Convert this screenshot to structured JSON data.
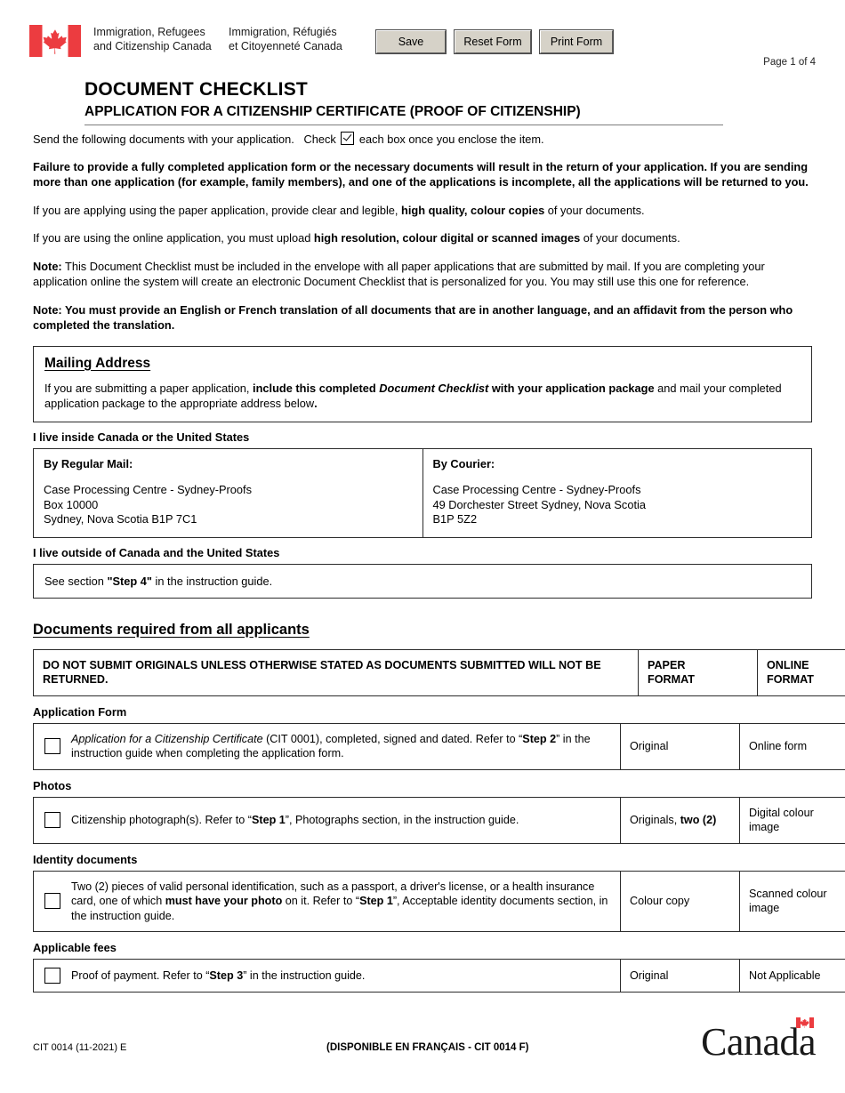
{
  "header": {
    "department_en": "Immigration, Refugees\nand Citizenship Canada",
    "department_fr": "Immigration, Réfugiés\net Citoyenneté Canada",
    "buttons": {
      "save": "Save",
      "reset": "Reset Form",
      "print": "Print Form"
    },
    "page_indicator": "Page 1 of 4"
  },
  "title": {
    "main": "DOCUMENT CHECKLIST",
    "sub": "APPLICATION FOR A CITIZENSHIP CERTIFICATE (PROOF OF CITIZENSHIP)"
  },
  "intro": {
    "line1_a": "Send the following documents with your application.",
    "line1_b": "Check",
    "line1_c": "each box once you enclose the item.",
    "warning": "Failure to provide a fully completed application form or the necessary documents will result in the return of your application. If you are sending more than one application (for example, family members), and one of the applications is incomplete, all the applications will be returned to you.",
    "paper_a": "If you are applying using the paper application, provide clear and legible, ",
    "paper_b": "high quality, colour copies",
    "paper_c": " of your documents.",
    "online_a": "If you are using the online application, you must upload ",
    "online_b": "high resolution, colour digital or scanned images",
    "online_c": " of your documents.",
    "note1_label": "Note:",
    "note1_text": " This Document Checklist must be included in the envelope with all paper applications that are submitted by mail. If you are completing your application online the system will create an electronic Document Checklist that is personalized for you. You may still use this one for reference.",
    "note2_text": "Note: You must provide an English or French translation of all documents that are in another language, and an affidavit from the person who completed the translation."
  },
  "mailing": {
    "heading": "Mailing Address",
    "text_a": "If you are submitting a paper application, ",
    "text_b": "include this completed ",
    "text_b_italic": "Document Checklist",
    "text_b2": " with your application package",
    "text_c": " and mail your completed application package to the appropriate address below",
    "text_d": ".",
    "inside_label": "I live inside Canada or the United States",
    "regular_mail_title": "By Regular Mail:",
    "regular_mail_address": "Case Processing Centre - Sydney-Proofs\nBox 10000\nSydney, Nova Scotia B1P 7C1",
    "courier_title": "By Courier:",
    "courier_address": "Case Processing Centre - Sydney-Proofs\n49 Dorchester Street Sydney, Nova Scotia\nB1P 5Z2",
    "outside_label": "I live outside of Canada and the United States",
    "outside_text_a": "See section ",
    "outside_text_b": "\"Step 4\"",
    "outside_text_c": " in the instruction guide."
  },
  "documents": {
    "section_title": "Documents required from all applicants",
    "table_header": {
      "notice": "DO NOT SUBMIT ORIGINALS UNLESS OTHERWISE STATED AS DOCUMENTS SUBMITTED WILL NOT BE RETURNED.",
      "paper_format": "PAPER\nFORMAT",
      "online_format": "ONLINE\nFORMAT"
    },
    "groups": [
      {
        "label": "Application Form",
        "row": {
          "desc_italic": "Application for a Citizenship Certificate",
          "desc_a": " (CIT 0001), completed, signed and dated. Refer to “",
          "desc_bold": "Step 2",
          "desc_b": "” in the instruction guide when completing the application form.",
          "paper": "Original",
          "online": "Online form"
        }
      },
      {
        "label": "Photos",
        "row": {
          "desc_a": "Citizenship photograph(s). Refer to “",
          "desc_bold": "Step 1",
          "desc_b": "”, Photographs section, in the instruction guide.",
          "paper_a": "Originals, ",
          "paper_bold": "two (2)",
          "online": "Digital colour image"
        }
      },
      {
        "label": "Identity documents",
        "row": {
          "desc_a": "Two (2) pieces of valid personal identification, such as a passport, a driver's license, or a health insurance card, one of which ",
          "desc_bold": "must have your photo",
          "desc_b": " on it. Refer to “",
          "desc_bold2": "Step 1",
          "desc_c": "”, Acceptable identity documents section, in the instruction guide.",
          "paper": "Colour copy",
          "online": "Scanned colour image"
        }
      },
      {
        "label": "Applicable fees",
        "row": {
          "desc_a": "Proof of payment. Refer to “",
          "desc_bold": "Step 3",
          "desc_b": "” in the instruction guide.",
          "paper": "Original",
          "online": "Not Applicable"
        }
      }
    ]
  },
  "footer": {
    "form_code": "CIT 0014 (11-2021) E",
    "french_note": "(DISPONIBLE EN FRANÇAIS - CIT 0014 F)",
    "wordmark": "Canada"
  },
  "colors": {
    "flag_red": "#e8112d",
    "button_face": "#d6d2c8",
    "border": "#2b2b2b"
  }
}
